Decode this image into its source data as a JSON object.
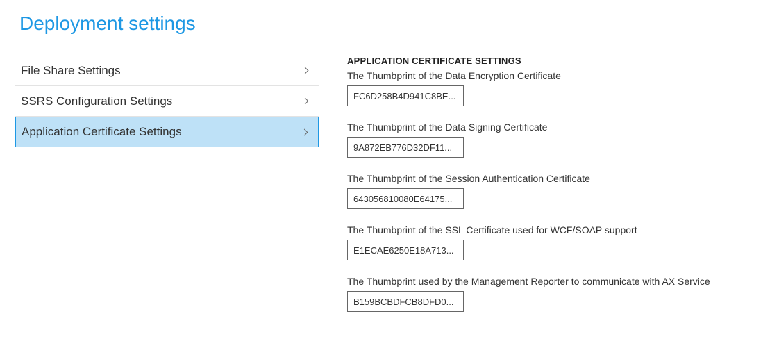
{
  "page_title": "Deployment settings",
  "sidebar": {
    "items": [
      {
        "label": "File Share Settings",
        "selected": false
      },
      {
        "label": "SSRS Configuration Settings",
        "selected": false
      },
      {
        "label": "Application Certificate Settings",
        "selected": true
      }
    ]
  },
  "detail": {
    "heading": "APPLICATION CERTIFICATE SETTINGS",
    "fields": [
      {
        "label": "The Thumbprint of the Data Encryption Certificate",
        "value": "FC6D258B4D941C8BE..."
      },
      {
        "label": "The Thumbprint of the Data Signing Certificate",
        "value": "9A872EB776D32DF11..."
      },
      {
        "label": "The Thumbprint of the Session Authentication Certificate",
        "value": "643056810080E64175..."
      },
      {
        "label": "The Thumbprint of the SSL Certificate used for WCF/SOAP support",
        "value": "E1ECAE6250E18A713..."
      },
      {
        "label": "The Thumbprint used by the Management Reporter to communicate with AX Service",
        "value": "B159BCBDFCB8DFD0..."
      }
    ]
  }
}
